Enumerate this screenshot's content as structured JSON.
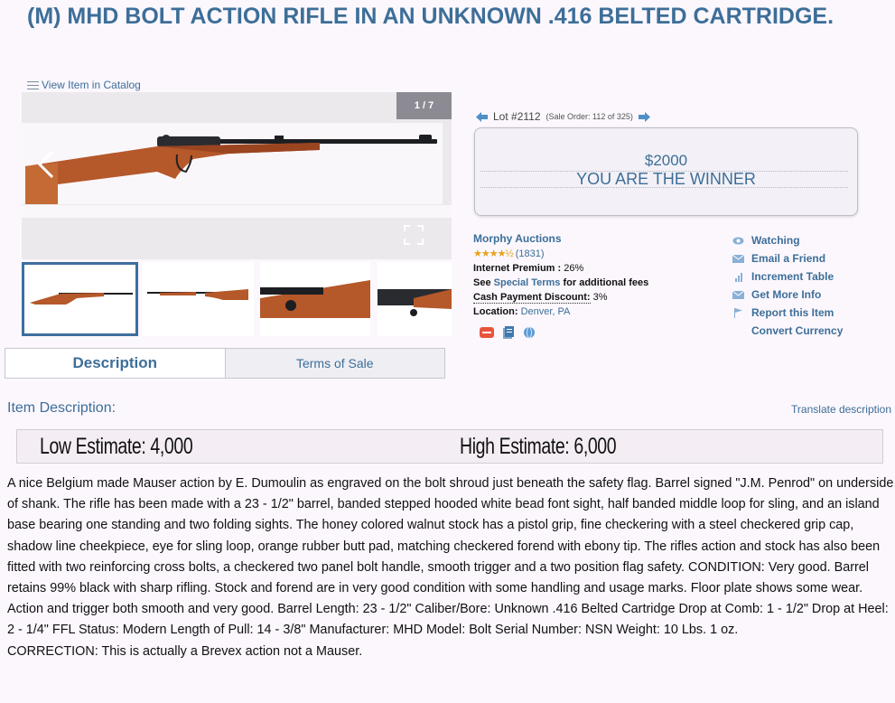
{
  "page": {
    "title": "(M) MHD BOLT ACTION RIFLE IN AN UNKNOWN .416 BELTED CARTRIDGE.",
    "catalog_link": "View Item in Catalog"
  },
  "gallery": {
    "counter": "1 / 7",
    "thumbnail_count": 4,
    "selected_index": 0
  },
  "lot": {
    "label": "Lot #2112",
    "sale_order": "(Sale Order: 112 of 325)"
  },
  "bid": {
    "amount": "$2000",
    "status": "YOU ARE THE WINNER"
  },
  "auctioneer": {
    "name": "Morphy Auctions",
    "stars": 4.5,
    "rating_count": "(1831)",
    "premium_label": "Internet Premium :",
    "premium_value": "26%",
    "see_text": "See",
    "special_terms": "Special Terms",
    "fees_text": "for additional fees",
    "cash_label": "Cash Payment Discount:",
    "cash_value": "3%",
    "location_label": "Location:",
    "location_value": "Denver, PA"
  },
  "actions": [
    {
      "label": "Watching",
      "icon": "eye-icon"
    },
    {
      "label": "Email a Friend",
      "icon": "envelope-icon"
    },
    {
      "label": "Increment Table",
      "icon": "bar-chart-icon"
    },
    {
      "label": "Get More Info",
      "icon": "envelope-icon"
    },
    {
      "label": "Report this Item",
      "icon": "flag-icon"
    },
    {
      "label": "Convert Currency",
      "icon": ""
    }
  ],
  "tabs": {
    "description": "Description",
    "terms": "Terms of Sale"
  },
  "description": {
    "heading": "Item Description:",
    "translate": "Translate description",
    "low_estimate": "Low Estimate: 4,000",
    "high_estimate": "High Estimate: 6,000",
    "body": "A nice Belgium made Mauser action by E. Dumoulin as engraved on the bolt shroud just beneath the safety flag. Barrel signed \"J.M. Penrod\" on underside of shank. The rifle has been made with a 23 - 1/2\" barrel, banded stepped hooded white bead font sight, half banded middle loop for sling, and an island base bearing one standing and two folding sights. The honey colored walnut stock has a pistol grip, fine checkering with a steel checkered grip cap, shadow line cheekpiece, eye for sling loop, orange rubber butt pad, matching checkered forend with ebony tip. The rifles action and stock has also been fitted with two reinforcing cross bolts, a checkered two panel bolt handle, smooth trigger and a two position flag safety. CONDITION: Very good. Barrel retains 99% black with sharp rifling. Stock and forend are in very good condition with some handling and usage marks. Floor plate shows some wear. Action and trigger both smooth and very good. Barrel Length: 23 - 1/2\" Caliber/Bore: Unknown .416 Belted Cartridge Drop at Comb: 1 - 1/2\" Drop at Heel: 2 - 1/4\" FFL Status: Modern Length of Pull: 14 - 3/8\" Manufacturer: MHD Model: Bolt Serial Number: NSN Weight: 10 Lbs. 1 oz.",
    "correction": "CORRECTION: This is actually a Brevex action not a Mauser."
  },
  "colors": {
    "accent": "#3d6e98",
    "star": "#e8a21a",
    "stock": "#b5582a",
    "metal": "#1d1e22"
  }
}
